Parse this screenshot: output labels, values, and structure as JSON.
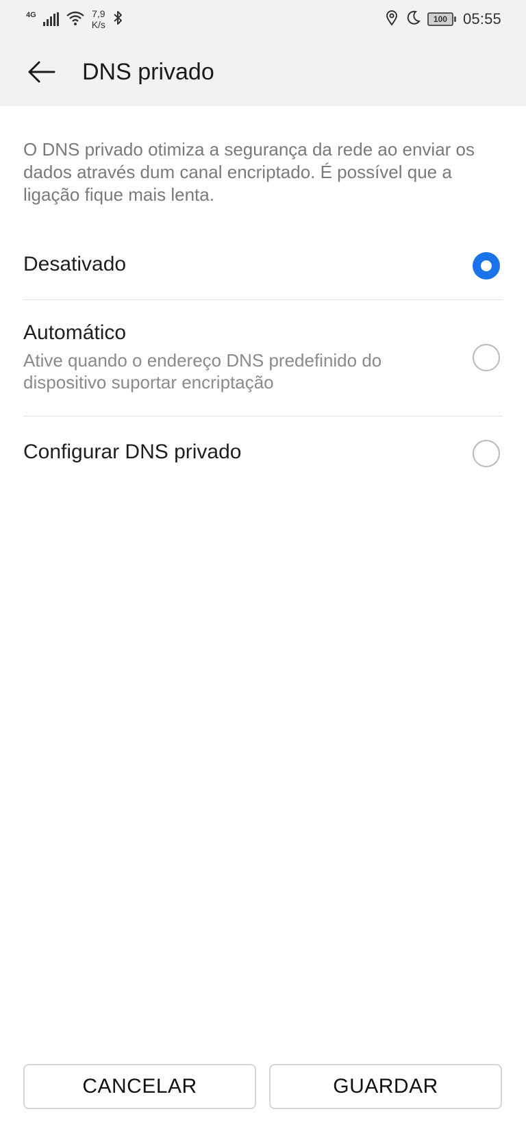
{
  "status_bar": {
    "network_type": "4G",
    "speed_value": "7,9",
    "speed_unit": "K/s",
    "battery_level": "100",
    "time": "05:55",
    "icons": [
      "signal-icon",
      "wifi-icon",
      "bluetooth-icon",
      "location-icon",
      "moon-icon",
      "battery-icon"
    ]
  },
  "app_bar": {
    "title": "DNS privado",
    "back_icon": "arrow-left-icon"
  },
  "description": "O DNS privado otimiza a segurança da rede ao enviar os dados através dum canal encriptado. É possível que a ligação fique mais lenta.",
  "options": [
    {
      "label": "Desativado",
      "subtitle": "",
      "checked": true
    },
    {
      "label": "Automático",
      "subtitle": "Ative quando o endereço DNS predefinido do dispositivo suportar encriptação",
      "checked": false
    },
    {
      "label": "Configurar DNS privado",
      "subtitle": "",
      "checked": false
    }
  ],
  "buttons": {
    "cancel": "CANCELAR",
    "save": "GUARDAR"
  },
  "colors": {
    "accent": "#1a73e8",
    "bar_background": "#f2f2f2"
  }
}
